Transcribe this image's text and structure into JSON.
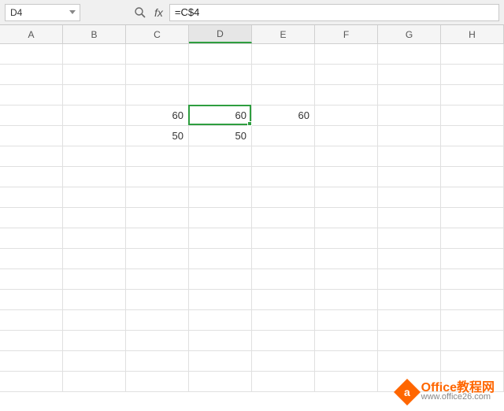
{
  "formula_bar": {
    "cell_ref": "D4",
    "formula": "=C$4"
  },
  "columns": [
    "A",
    "B",
    "C",
    "D",
    "E",
    "F",
    "G",
    "H"
  ],
  "active_column_index": 3,
  "rows_count": 17,
  "cells": {
    "r3": {
      "C": "60",
      "D": "60",
      "E": "60"
    },
    "r4": {
      "C": "50",
      "D": "50"
    }
  },
  "active_cell": {
    "row": 3,
    "col": 3
  },
  "watermark": {
    "brand": "Office教程网",
    "url": "www.office26.com",
    "logo_letter": "a"
  }
}
